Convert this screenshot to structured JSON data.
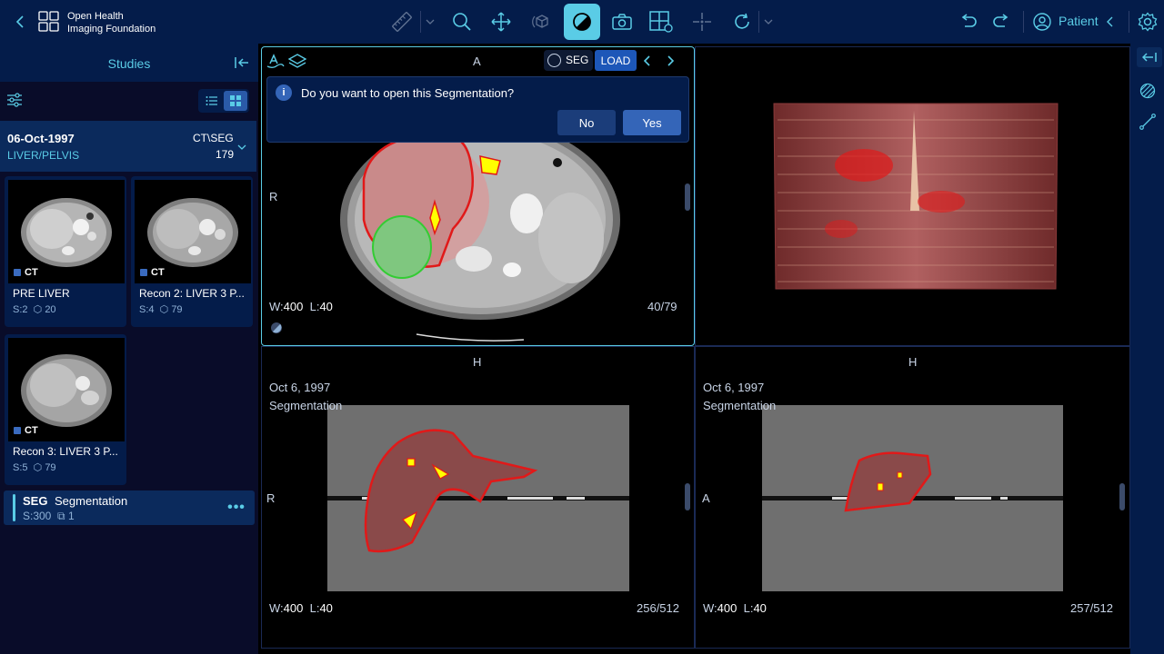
{
  "header": {
    "logo_line1": "Open Health",
    "logo_line2": "Imaging Foundation",
    "patient_label": "Patient"
  },
  "icons": [
    "back-icon",
    "logo-icon",
    "ruler-icon",
    "chevron-down-icon",
    "zoom-icon",
    "pan-icon",
    "3d-rotate-icon",
    "window-level-icon",
    "camera-icon",
    "layout-icon",
    "crosshair-icon",
    "reset-icon",
    "undo-icon",
    "redo-icon",
    "user-icon",
    "gear-icon"
  ],
  "sidebar": {
    "title": "Studies",
    "study": {
      "date": "06-Oct-1997",
      "description": "LIVER/PELVIS",
      "modality": "CT\\SEG",
      "count": "179"
    },
    "series": [
      {
        "modality": "CT",
        "title": "PRE LIVER",
        "series_num": "S:2",
        "instances": "20"
      },
      {
        "modality": "CT",
        "title": "Recon 2: LIVER 3 P...",
        "series_num": "S:4",
        "instances": "79"
      },
      {
        "modality": "CT",
        "title": "Recon 3: LIVER 3 P...",
        "series_num": "S:5",
        "instances": "79"
      }
    ],
    "seg_item": {
      "modality": "SEG",
      "title": "Segmentation",
      "series_num": "S:300",
      "instances": "1"
    }
  },
  "viewport_toolbar": {
    "orientation": "A",
    "seg_toggle": "SEG",
    "load_label": "LOAD"
  },
  "dialog": {
    "message": "Do you want to open this Segmentation?",
    "no_label": "No",
    "yes_label": "Yes"
  },
  "viewports": {
    "axial": {
      "left_marker": "R",
      "ww_label": "W:",
      "ww": "400",
      "wl_label": "L:",
      "wl": "40",
      "slice": "40/79"
    },
    "coronal": {
      "top_marker": "H",
      "date": "Oct 6, 1997",
      "label": "Segmentation",
      "left_marker": "R",
      "ww_label": "W:",
      "ww": "400",
      "wl_label": "L:",
      "wl": "40",
      "slice": "256/512"
    },
    "sagittal": {
      "top_marker": "H",
      "date": "Oct 6, 1997",
      "label": "Segmentation",
      "left_marker": "A",
      "ww_label": "W:",
      "ww": "400",
      "wl_label": "L:",
      "wl": "40",
      "slice": "257/512"
    }
  },
  "colors": {
    "header_bg": "#041c4a",
    "accent": "#5acce6",
    "seg_red": "#e11919",
    "seg_yellow": "#ffff00",
    "seg_green": "#33cc33"
  }
}
